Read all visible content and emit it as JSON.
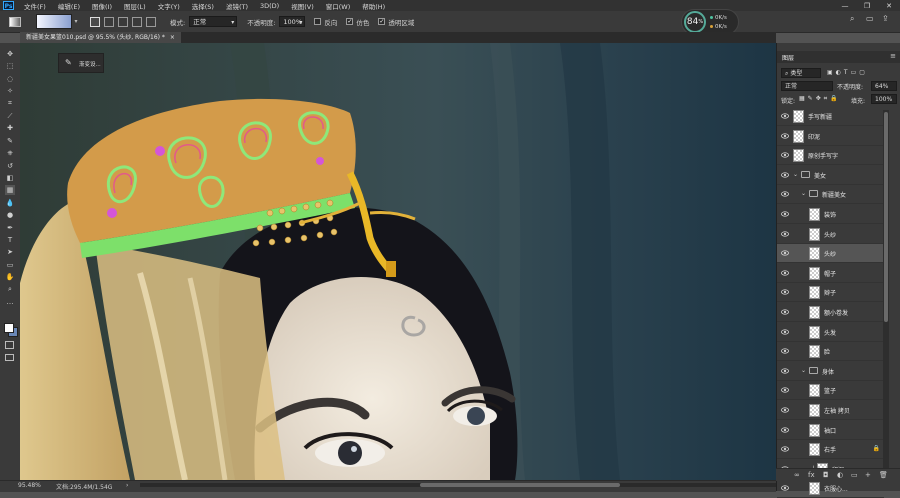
{
  "menubar": {
    "logo": "Ps",
    "items": [
      "文件(F)",
      "编辑(E)",
      "图像(I)",
      "图层(L)",
      "文字(Y)",
      "选择(S)",
      "滤镜(T)",
      "3D(D)",
      "视图(V)",
      "窗口(W)",
      "帮助(H)"
    ],
    "window_buttons": [
      "—",
      "❐",
      "✕"
    ]
  },
  "options": {
    "mode_label": "模式:",
    "mode_value": "正常",
    "opacity_label": "不透明度:",
    "opacity_value": "100%",
    "reverse_label": "反向",
    "reverse_checked": false,
    "dither_label": "仿色",
    "dither_checked": true,
    "transparency_label": "透明区域",
    "transparency_checked": true
  },
  "perf": {
    "percent": "84",
    "unit": "%",
    "row1": "0K/s",
    "row2": "0K/s",
    "ring_color": "#55aa99",
    "dot1_color": "#4fc3a1",
    "dot2_color": "#d8a23a"
  },
  "doc": {
    "tab_title": "新疆美女果篮010.psd @ 95.5% (头纱, RGB/16) *",
    "close": "×"
  },
  "preset_panel": {
    "label": "渐变设..."
  },
  "status": {
    "zoom": "95.48%",
    "doc_info": "文档:295.4M/1.54G",
    "arrow": "›"
  },
  "layers": {
    "panel_title": "图层",
    "kind_label": "类型",
    "blend_mode": "正常",
    "opacity_label": "不透明度:",
    "opacity_value": "64%",
    "lock_label": "锁定:",
    "fill_label": "填充:",
    "fill_value": "100%",
    "rows": [
      {
        "name": "手写新疆",
        "type": "layer",
        "indent": 0,
        "selected": false
      },
      {
        "name": "印泥",
        "type": "layer",
        "indent": 0,
        "selected": false
      },
      {
        "name": "原创手写字",
        "type": "layer",
        "indent": 0,
        "selected": false
      },
      {
        "name": "美女",
        "type": "group",
        "indent": 0,
        "selected": false
      },
      {
        "name": "新疆美女",
        "type": "group",
        "indent": 1,
        "selected": false
      },
      {
        "name": "装饰",
        "type": "layer",
        "indent": 2,
        "selected": false
      },
      {
        "name": "头纱",
        "type": "layer",
        "indent": 2,
        "selected": false
      },
      {
        "name": "头纱",
        "type": "layer",
        "indent": 2,
        "selected": true
      },
      {
        "name": "帽子",
        "type": "layer",
        "indent": 2,
        "selected": false
      },
      {
        "name": "辫子",
        "type": "layer",
        "indent": 2,
        "selected": false
      },
      {
        "name": "额小卷发",
        "type": "layer",
        "indent": 2,
        "selected": false
      },
      {
        "name": "头发",
        "type": "layer",
        "indent": 2,
        "selected": false
      },
      {
        "name": "脸",
        "type": "layer",
        "indent": 2,
        "selected": false
      },
      {
        "name": "身体",
        "type": "group",
        "indent": 1,
        "selected": false
      },
      {
        "name": "篮子",
        "type": "layer",
        "indent": 2,
        "selected": false
      },
      {
        "name": "左袖 拷贝",
        "type": "layer",
        "indent": 2,
        "selected": false
      },
      {
        "name": "袖口",
        "type": "layer",
        "indent": 2,
        "selected": false
      },
      {
        "name": "右手",
        "type": "layer",
        "indent": 2,
        "selected": false
      },
      {
        "name": "印泥",
        "type": "layer",
        "indent": 3,
        "selected": false
      },
      {
        "name": "衣服心...",
        "type": "layer",
        "indent": 2,
        "selected": false
      }
    ],
    "footer_icons": [
      "link-icon",
      "fx-icon",
      "mask-icon",
      "adjustment-icon",
      "folder-icon",
      "new-layer-icon",
      "trash-icon"
    ],
    "footer_glyphs": [
      "∞",
      "fx",
      "◘",
      "◐",
      "▭",
      "+",
      "🗑"
    ]
  }
}
